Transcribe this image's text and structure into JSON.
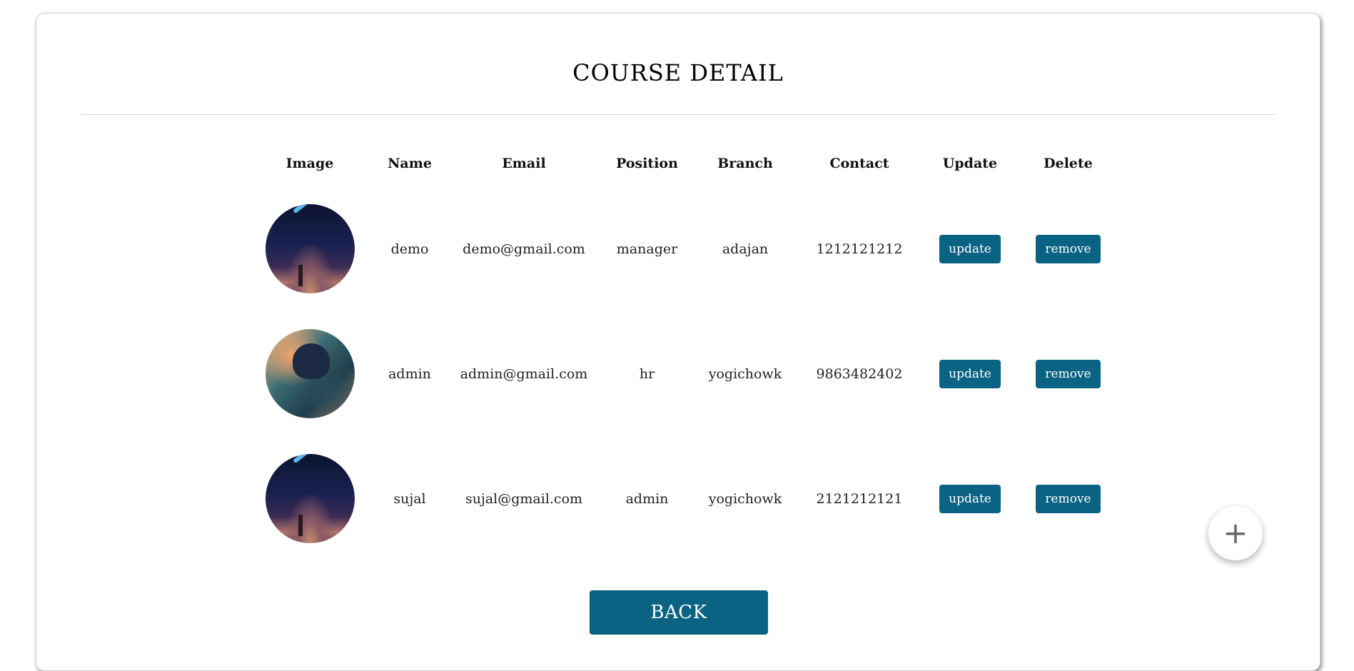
{
  "page": {
    "title": "COURSE DETAIL",
    "back_label": "BACK",
    "fab_icon": "plus-icon",
    "fab_glyph": "+"
  },
  "table": {
    "headers": [
      "Image",
      "Name",
      "Email",
      "Position",
      "Branch",
      "Contact",
      "Update",
      "Delete"
    ],
    "rows": [
      {
        "image": "avatar-comet",
        "name": "demo",
        "email": "demo@gmail.com",
        "position": "manager",
        "branch": "adajan",
        "contact": "1212121212",
        "update_label": "update",
        "delete_label": "remove"
      },
      {
        "image": "avatar-city",
        "name": "admin",
        "email": "admin@gmail.com",
        "position": "hr",
        "branch": "yogichowk",
        "contact": "9863482402",
        "update_label": "update",
        "delete_label": "remove"
      },
      {
        "image": "avatar-comet",
        "name": "sujal",
        "email": "sujal@gmail.com",
        "position": "admin",
        "branch": "yogichowk",
        "contact": "2121212121",
        "update_label": "update",
        "delete_label": "remove"
      }
    ]
  },
  "colors": {
    "accent": "#0a6382",
    "divider": "#d6d6d6"
  }
}
